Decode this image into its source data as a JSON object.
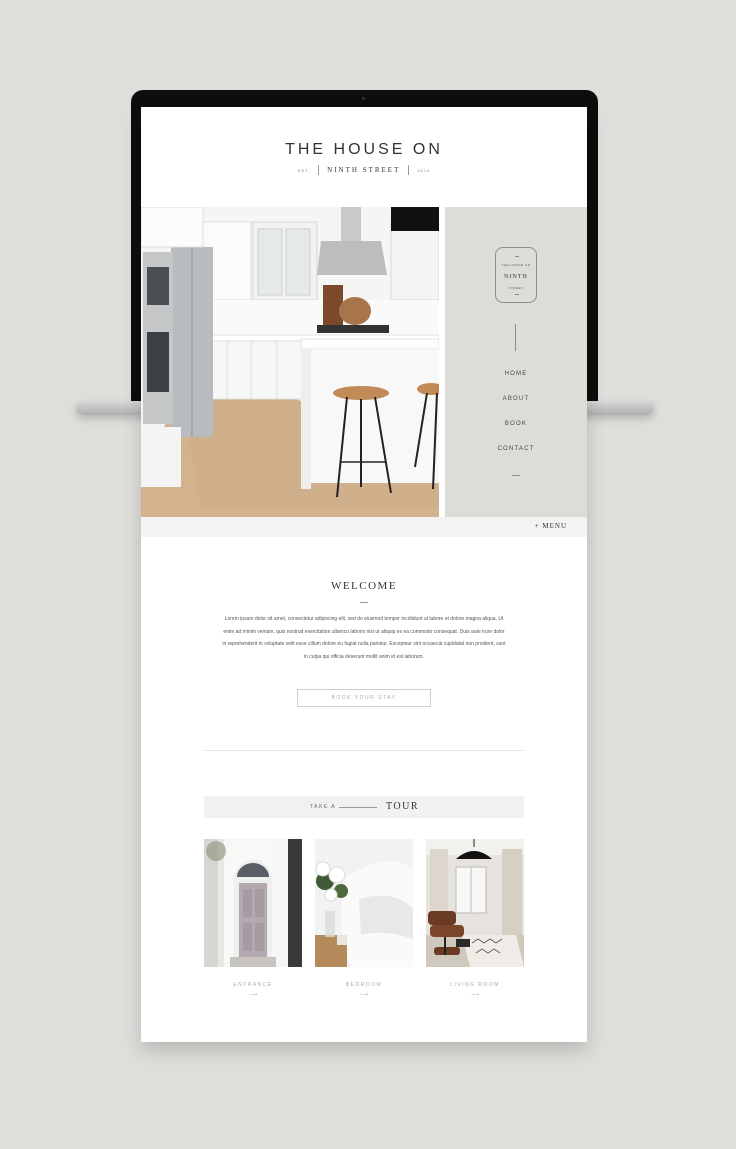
{
  "site": {
    "title": "THE HOUSE ON",
    "subtitle": "NINTH STREET",
    "est_left": "EST.",
    "est_right": "2014"
  },
  "logo_badge": {
    "top": "THE HOUSE ON",
    "main": "NINTH",
    "bottom": "STREET"
  },
  "nav": {
    "items": [
      {
        "label": "HOME"
      },
      {
        "label": "ABOUT"
      },
      {
        "label": "BOOK"
      },
      {
        "label": "CONTACT"
      }
    ],
    "menu_label": "+ MENU"
  },
  "welcome": {
    "title": "WELCOME",
    "body": "Lorem ipsum dolor sit amet, consectetur adipiscing elit, sed do eiusmod tempor incididunt ut labore et dolore magna aliqua. Ut enim ad minim veniam, quis nostrud exercitation ullamco laboris nisi ut aliquip ex ea commodo consequat. Duis aute irure dolor in reprehenderit in voluptate velit esse cillum dolore eu fugiat nulla pariatur. Excepteur sint occaecat cupidatat non proident, sunt in culpa qui officia deserunt mollit anim id est laborum.",
    "button_label": "BOOK YOUR STAY"
  },
  "tour": {
    "prefix": "TAKE A",
    "title": "TOUR",
    "cards": [
      {
        "label": "ENTRANCE",
        "arrow": "⟶"
      },
      {
        "label": "BEDROOM",
        "arrow": "⟶"
      },
      {
        "label": "LIVING ROOM",
        "arrow": "⟶"
      }
    ]
  },
  "colors": {
    "background": "#e0dedb",
    "panel": "#dcddd8",
    "menu_bar": "#f3f3f2",
    "tour_bar": "#f1f1f0"
  }
}
